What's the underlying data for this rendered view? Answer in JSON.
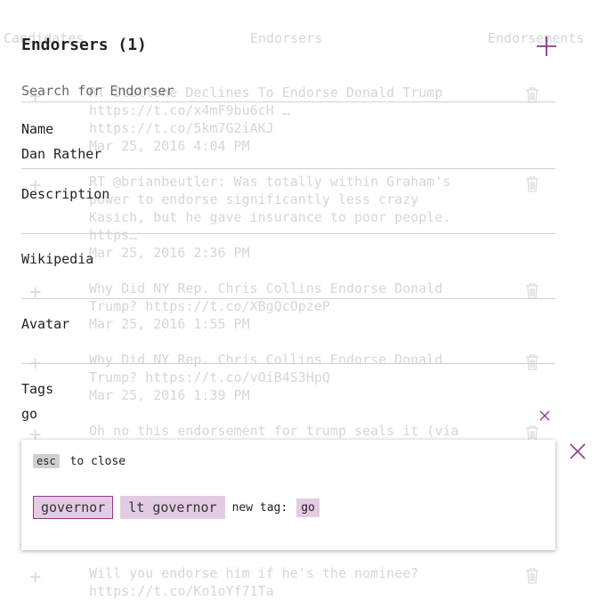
{
  "background": {
    "tabs": [
      "Candidates",
      "Endorsers",
      "Endorsements"
    ],
    "feed": [
      {
        "text": "RT Stallone Declines To Endorse Donald Trump https://t.co/x4mF9bu6cH … https://t.co/5km7G2iAKJ",
        "time": "Mar 25, 2016 4:04 PM"
      },
      {
        "text": "RT @brianbeutler: Was totally within Graham's power to endorse significantly less crazy Kasich, but he gave insurance to poor people. https…",
        "time": "Mar 25, 2016 2:36 PM"
      },
      {
        "text": "Why Did NY Rep. Chris Collins Endorse Donald Trump? https://t.co/XBgQcOpzeP",
        "time": "Mar 25, 2016 1:55 PM"
      },
      {
        "text": "Why Did NY Rep. Chris Collins Endorse Donald Trump? https://t.co/vOiB4S3HpQ",
        "time": "Mar 25, 2016 1:39 PM"
      },
      {
        "text": "Oh no this endorsement for trump seals it (via",
        "time": ""
      },
      {
        "text": "Will you endorse him if he's the nominee? https://t.co/Ko1oYf71Ta",
        "time": ""
      }
    ]
  },
  "form": {
    "title": "Endorsers (1)",
    "search_placeholder": "Search for Endorser",
    "name_label": "Name",
    "name_value": "Dan Rather",
    "description_label": "Description",
    "description_value": "",
    "wikipedia_label": "Wikipedia",
    "wikipedia_value": "",
    "avatar_label": "Avatar",
    "avatar_value": "",
    "tags_label": "Tags",
    "tags_value": "go"
  },
  "dropdown": {
    "esc_key": "esc",
    "esc_text": "to close",
    "options": [
      "governor",
      "lt governor"
    ],
    "new_tag_label": "new tag:",
    "new_tag_value": "go"
  },
  "colors": {
    "accent": "#8e3a8e",
    "chip_bg": "#e3cbe3"
  }
}
